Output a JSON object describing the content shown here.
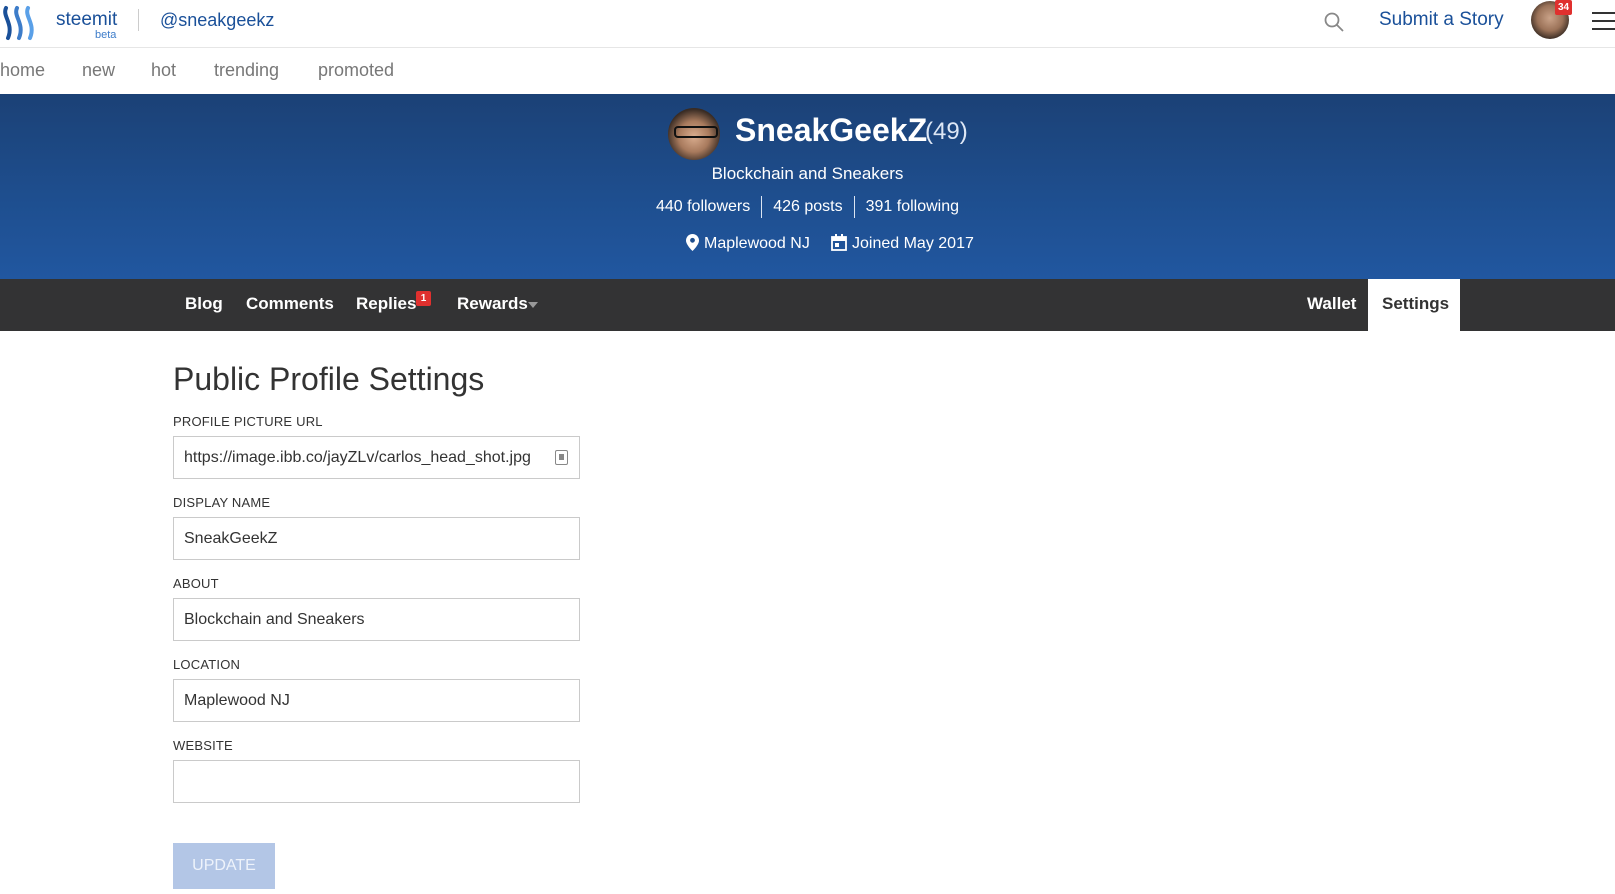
{
  "header": {
    "brand": "steemit",
    "brand_tag": "beta",
    "username": "@sneakgeekz",
    "submit_label": "Submit a Story",
    "notification_count": "34"
  },
  "subnav": {
    "items": [
      {
        "label": "home"
      },
      {
        "label": "new"
      },
      {
        "label": "hot"
      },
      {
        "label": "trending"
      },
      {
        "label": "promoted"
      }
    ]
  },
  "profile": {
    "display_name": "SneakGeekZ",
    "reputation": "(49)",
    "about": "Blockchain and Sneakers",
    "followers": "440 followers",
    "posts": "426 posts",
    "following": "391 following",
    "location": "Maplewood NJ",
    "joined": "Joined May 2017"
  },
  "tabs": {
    "blog": "Blog",
    "comments": "Comments",
    "replies": "Replies",
    "replies_badge": "1",
    "rewards": "Rewards",
    "wallet": "Wallet",
    "settings": "Settings"
  },
  "settings": {
    "title": "Public Profile Settings",
    "picture_label": "PROFILE PICTURE URL",
    "picture_value": "https://image.ibb.co/jayZLv/carlos_head_shot.jpg",
    "name_label": "DISPLAY NAME",
    "name_value": "SneakGeekZ",
    "about_label": "ABOUT",
    "about_value": "Blockchain and Sneakers",
    "location_label": "LOCATION",
    "location_value": "Maplewood NJ",
    "website_label": "WEBSITE",
    "website_value": "",
    "update_label": "UPDATE"
  },
  "colors": {
    "brand_blue": "#1a5099",
    "banner_blue": "#1e4e8e",
    "tab_bar": "#333334",
    "badge_red": "#e0302e",
    "button_disabled": "#b3c6e6"
  }
}
